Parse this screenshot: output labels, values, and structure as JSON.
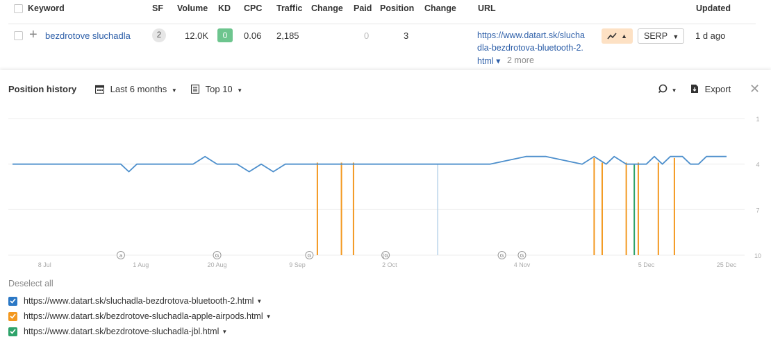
{
  "table": {
    "headers": {
      "keyword": "Keyword",
      "sf": "SF",
      "volume": "Volume",
      "kd": "KD",
      "cpc": "CPC",
      "traffic": "Traffic",
      "change": "Change",
      "paid": "Paid",
      "position": "Position",
      "change2": "Change",
      "url": "URL",
      "updated": "Updated"
    },
    "row": {
      "plus": "+",
      "keyword": "bezdrotove sluchadla",
      "sf": "2",
      "volume": "12.0K",
      "kd": "0",
      "cpc": "0.06",
      "traffic": "2,185",
      "paid": "0",
      "position": "3",
      "url_line1": "https://www.datart.sk/slucha",
      "url_line2": "dla-bezdrotova-bluetooth-2.",
      "url_line3": "html ▾",
      "more": "2 more",
      "trend_icon": "trend-up-icon",
      "trend_caret": "▲",
      "serp_label": "SERP",
      "updated": "1 d ago"
    }
  },
  "history": {
    "title": "Position history",
    "range_label": "Last 6 months",
    "top_label": "Top 10",
    "export_label": "Export",
    "deselect_all": "Deselect all"
  },
  "colors": {
    "blue_series": "#4d8fcc",
    "orange_series": "#f3981f",
    "green_series": "#2ea36a",
    "light_blue_marker": "#b8d3ea"
  },
  "chart_data": {
    "type": "line",
    "x_ticks": [
      "8 Jul",
      "1 Aug",
      "20 Aug",
      "9 Sep",
      "2 Oct",
      "4 Nov",
      "5 Dec",
      "25 Dec"
    ],
    "y_ticks": [
      "1",
      "4",
      "7",
      "10"
    ],
    "ylim": [
      1,
      10
    ],
    "y_inverted": true,
    "grid": true,
    "series": [
      {
        "name": "https://www.datart.sk/sluchadla-bezdrotova-bluetooth-2.html",
        "color": "#4d8fcc",
        "checked": true,
        "points": [
          [
            "2024-06-30",
            4
          ],
          [
            "2024-07-27",
            4
          ],
          [
            "2024-07-29",
            4.5
          ],
          [
            "2024-07-31",
            4
          ],
          [
            "2024-08-14",
            4
          ],
          [
            "2024-08-17",
            3.5
          ],
          [
            "2024-08-20",
            4
          ],
          [
            "2024-08-25",
            4
          ],
          [
            "2024-08-28",
            4.5
          ],
          [
            "2024-08-31",
            4
          ],
          [
            "2024-09-03",
            4.5
          ],
          [
            "2024-09-06",
            4
          ],
          [
            "2024-10-27",
            4
          ],
          [
            "2024-11-05",
            3.5
          ],
          [
            "2024-11-10",
            3.5
          ],
          [
            "2024-11-19",
            4
          ],
          [
            "2024-11-22",
            3.5
          ],
          [
            "2024-11-25",
            4
          ],
          [
            "2024-11-27",
            3.5
          ],
          [
            "2024-11-30",
            4
          ],
          [
            "2024-12-05",
            4
          ],
          [
            "2024-12-07",
            3.5
          ],
          [
            "2024-12-09",
            4
          ],
          [
            "2024-12-11",
            3.5
          ],
          [
            "2024-12-14",
            3.5
          ],
          [
            "2024-12-16",
            4
          ],
          [
            "2024-12-18",
            4
          ],
          [
            "2024-12-20",
            3.5
          ],
          [
            "2024-12-25",
            3.5
          ]
        ]
      },
      {
        "name": "https://www.datart.sk/bezdrotove-sluchadla-apple-airpods.html",
        "color": "#f3981f",
        "checked": true,
        "drops": [
          [
            "2024-09-14",
            3.9
          ],
          [
            "2024-09-20",
            3.9
          ],
          [
            "2024-09-23",
            3.9
          ],
          [
            "2024-11-22",
            3.6
          ],
          [
            "2024-11-24",
            3.9
          ],
          [
            "2024-11-30",
            3.9
          ],
          [
            "2024-12-03",
            3.9
          ],
          [
            "2024-12-08",
            3.9
          ],
          [
            "2024-12-12",
            3.6
          ]
        ]
      },
      {
        "name": "https://www.datart.sk/bezdrotove-sluchadla-jbl.html",
        "color": "#2ea36a",
        "checked": true,
        "drops": [
          [
            "2024-12-02",
            4
          ]
        ]
      }
    ],
    "markers": [
      {
        "date": "2024-07-27",
        "label": "a"
      },
      {
        "date": "2024-08-20",
        "label": "G"
      },
      {
        "date": "2024-09-12",
        "label": "G"
      },
      {
        "date": "2024-10-01",
        "label": "(G"
      },
      {
        "date": "2024-10-14",
        "label": ""
      },
      {
        "date": "2024-10-30",
        "label": "G"
      },
      {
        "date": "2024-11-04",
        "label": "G"
      }
    ]
  }
}
